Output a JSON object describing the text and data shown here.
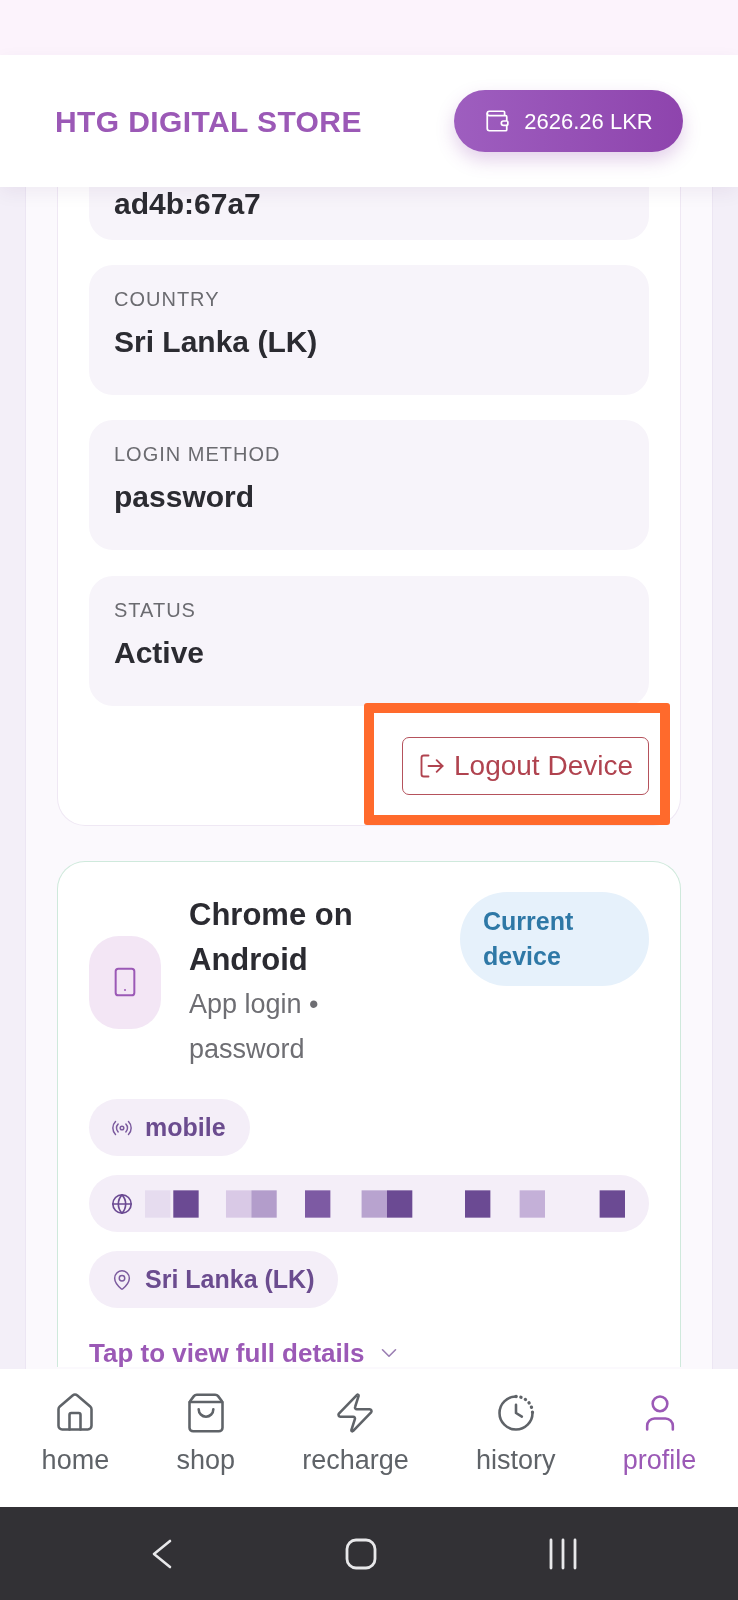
{
  "header": {
    "title": "HTG DIGITAL STORE",
    "balance": "2626.26 LKR"
  },
  "session_card": {
    "partial_value": "ad4b:67a7",
    "fields": [
      {
        "label": "COUNTRY",
        "value": "Sri Lanka (LK)"
      },
      {
        "label": "LOGIN METHOD",
        "value": "password"
      },
      {
        "label": "STATUS",
        "value": "Active"
      }
    ],
    "logout_button": {
      "label": "Logout Device",
      "highlighted": true
    }
  },
  "device_card": {
    "title": "Chrome on Android",
    "subtitle": "App login • password",
    "badge": "Current device",
    "chips": [
      {
        "kind": "connection",
        "text": "mobile"
      },
      {
        "kind": "ip"
      },
      {
        "kind": "location",
        "text": "Sri Lanka (LK)"
      }
    ],
    "details_link": "Tap to view full details"
  },
  "bottom_nav": [
    {
      "label": "home",
      "selected": false
    },
    {
      "label": "shop",
      "selected": false
    },
    {
      "label": "recharge",
      "selected": false
    },
    {
      "label": "history",
      "selected": false
    },
    {
      "label": "profile",
      "selected": true
    }
  ]
}
